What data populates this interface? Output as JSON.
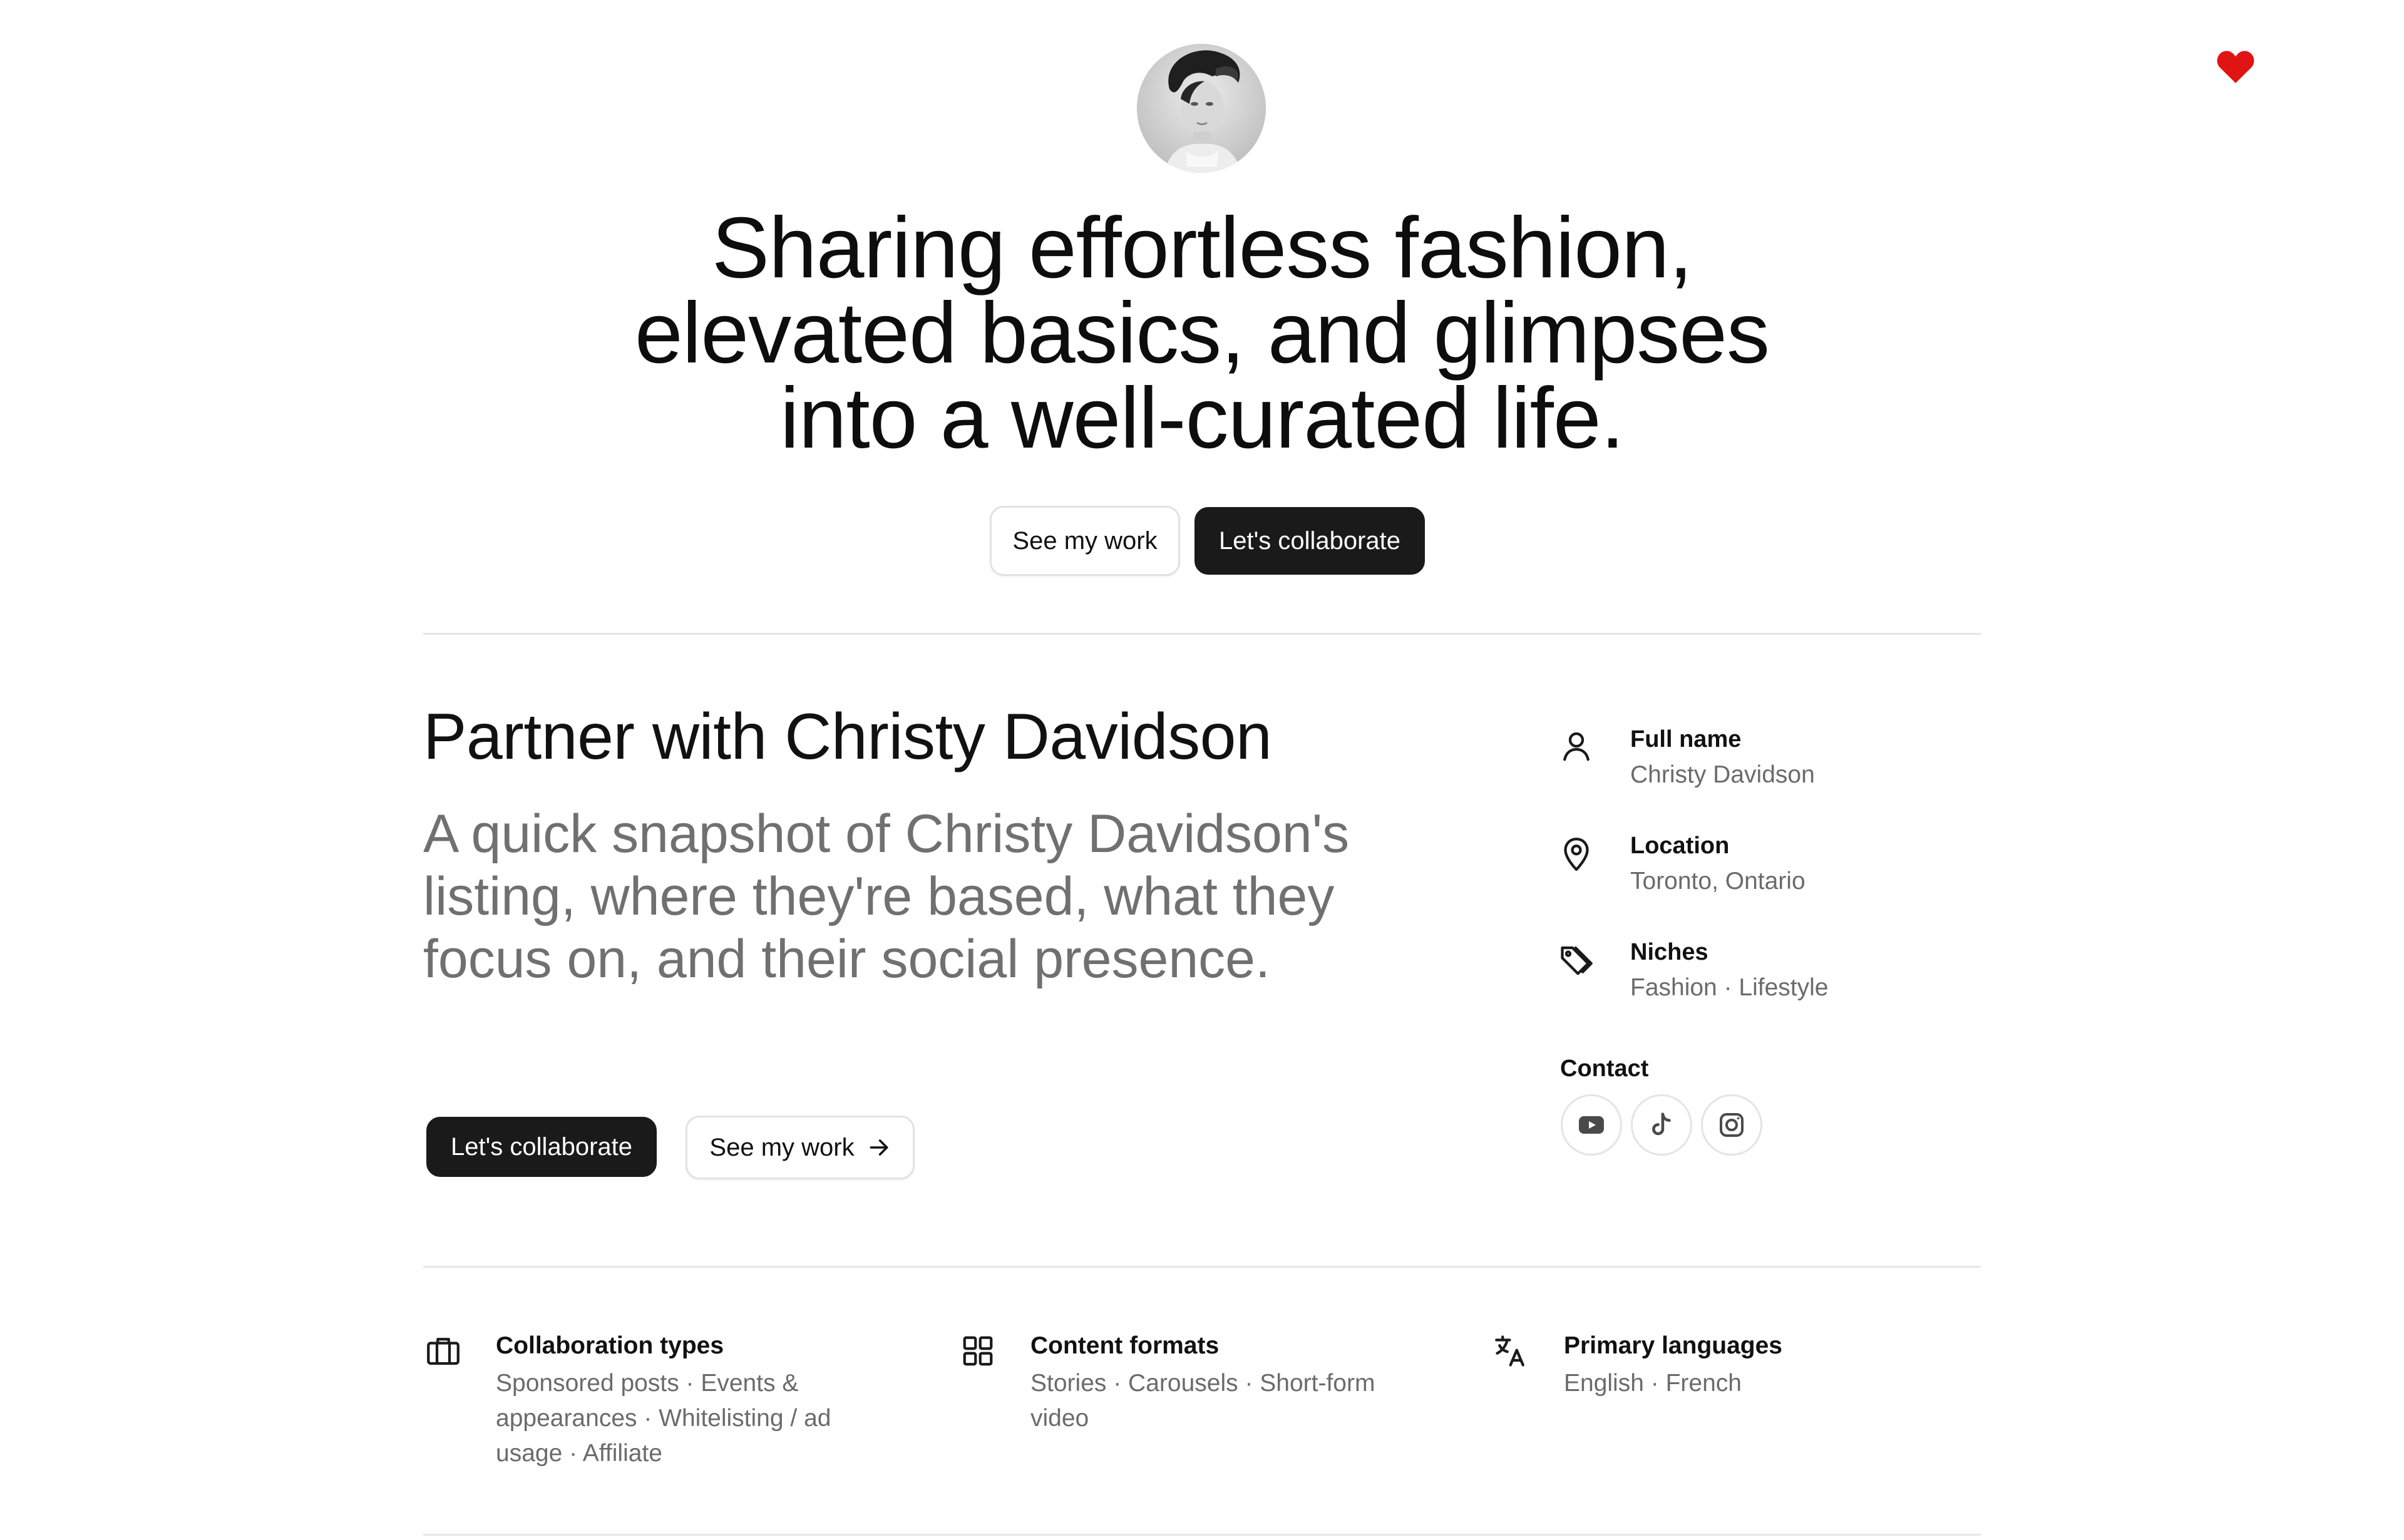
{
  "header": {
    "favorite_icon": "heart-icon",
    "favorite_color": "#e11414",
    "avatar_alt": "profile photo"
  },
  "hero": {
    "title_lines": [
      "Sharing effortless fashion,",
      "elevated basics, and glimpses",
      "into a well-curated life."
    ],
    "see_work_label": "See my work",
    "collaborate_label": "Let's collaborate"
  },
  "partner": {
    "title": "Partner with Christy Davidson",
    "description": "A quick snapshot of Christy Davidson's listing, where they're based, what they focus on, and their social presence.",
    "collaborate_label": "Let's collaborate",
    "see_work_label": "See my work",
    "arrow_icon": "arrow-right-icon"
  },
  "profile": {
    "full_name_label": "Full name",
    "full_name_value": "Christy Davidson",
    "location_label": "Location",
    "location_value": "Toronto, Ontario",
    "niches_label": "Niches",
    "niches_value": "Fashion · Lifestyle",
    "contact_label": "Contact",
    "social_icons": [
      "youtube-icon",
      "tiktok-icon",
      "instagram-icon"
    ]
  },
  "features": [
    {
      "icon": "briefcase-icon",
      "label": "Collaboration types",
      "value": "Sponsored posts · Events & appearances · Whitelisting / ad usage · Affiliate"
    },
    {
      "icon": "grid-icon",
      "label": "Content formats",
      "value": "Stories · Carousels · Short-form video"
    },
    {
      "icon": "translate-icon",
      "label": "Primary languages",
      "value": "English · French"
    }
  ],
  "colors": {
    "accent_dark": "#1a1a1a",
    "muted_text": "#6b6b6b",
    "divider": "#e6e6e6"
  }
}
